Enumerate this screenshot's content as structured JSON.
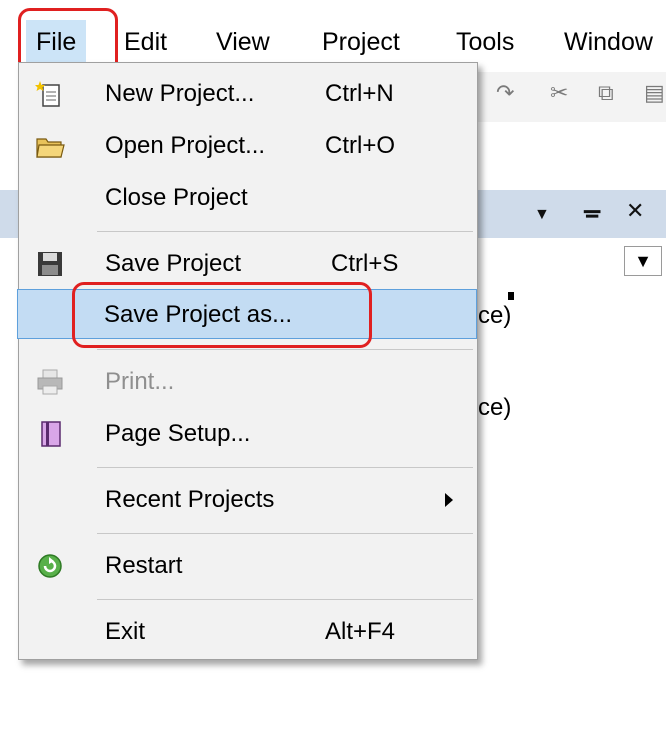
{
  "menubar": {
    "items": [
      {
        "label": "File"
      },
      {
        "label": "Edit"
      },
      {
        "label": "View"
      },
      {
        "label": "Project"
      },
      {
        "label": "Tools"
      },
      {
        "label": "Window"
      }
    ]
  },
  "toolbar": {
    "icons": [
      "redo-icon",
      "cut-icon",
      "copy-icon",
      "paste-icon"
    ]
  },
  "panel": {
    "dropdown_arrow": "▼",
    "pin_glyph": "ꟸ",
    "close_glyph": "✕",
    "menu_glyph": "▼",
    "text_1": "ce)",
    "text_2": "ce)"
  },
  "file_menu": {
    "items": [
      {
        "label": "New Project...",
        "shortcut": "Ctrl+N",
        "icon": "new-project-icon"
      },
      {
        "label": "Open Project...",
        "shortcut": "Ctrl+O",
        "icon": "open-folder-icon"
      },
      {
        "label": "Close Project",
        "shortcut": ""
      },
      {
        "label": "Save Project",
        "shortcut": "Ctrl+S",
        "icon": "save-disk-icon"
      },
      {
        "label": "Save Project as...",
        "shortcut": ""
      },
      {
        "label": "Print...",
        "shortcut": "",
        "icon": "printer-icon",
        "disabled": true
      },
      {
        "label": "Page Setup...",
        "shortcut": "",
        "icon": "page-setup-icon"
      },
      {
        "label": "Recent Projects",
        "shortcut": "",
        "submenu": true
      },
      {
        "label": "Restart",
        "shortcut": "",
        "icon": "restart-icon"
      },
      {
        "label": "Exit",
        "shortcut": "Alt+F4"
      }
    ]
  },
  "colors": {
    "highlight_ring": "#e02020",
    "hover_bg": "#c3dcf3",
    "panel_header": "#cfdbea"
  }
}
